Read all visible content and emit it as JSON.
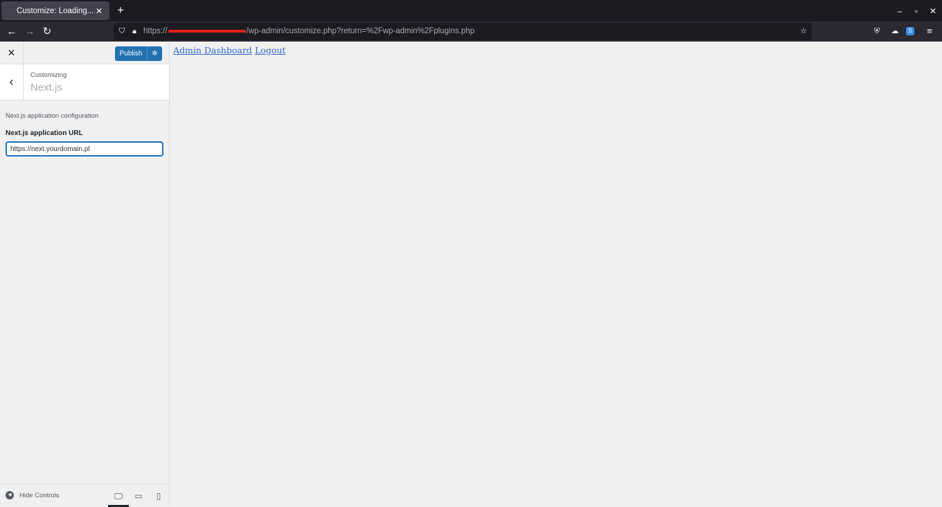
{
  "browser": {
    "tab_title": "Customize: Loading...",
    "tab_close": "✕",
    "new_tab": "+",
    "window_controls": {
      "minimize": "–",
      "maximize": "▫",
      "close": "✕"
    },
    "url": {
      "scheme": "https://",
      "path": "/wp-admin/customize.php?return=%2Fwp-admin%2Fplugins.php"
    },
    "icons": [
      "back-icon",
      "forward-icon",
      "reload-icon",
      "shield-icon",
      "lock-icon",
      "bookmark-star-icon",
      "pocket-icon",
      "extension-icon",
      "account-icon",
      "menu-icon"
    ]
  },
  "customizer": {
    "publish_label": "Publish",
    "customizing_label": "Customizing",
    "section_name": "Next.js",
    "description": "Next.js application configuration",
    "field_label": "Next.js application URL",
    "field_value": "https://next.yourdomain.pl",
    "hide_controls": "Hide Controls",
    "devices": [
      "desktop",
      "tablet",
      "mobile"
    ],
    "active_device": "desktop",
    "accent_color": "#2271b1"
  },
  "preview": {
    "links": [
      "Admin Dashboard",
      "Logout"
    ]
  }
}
